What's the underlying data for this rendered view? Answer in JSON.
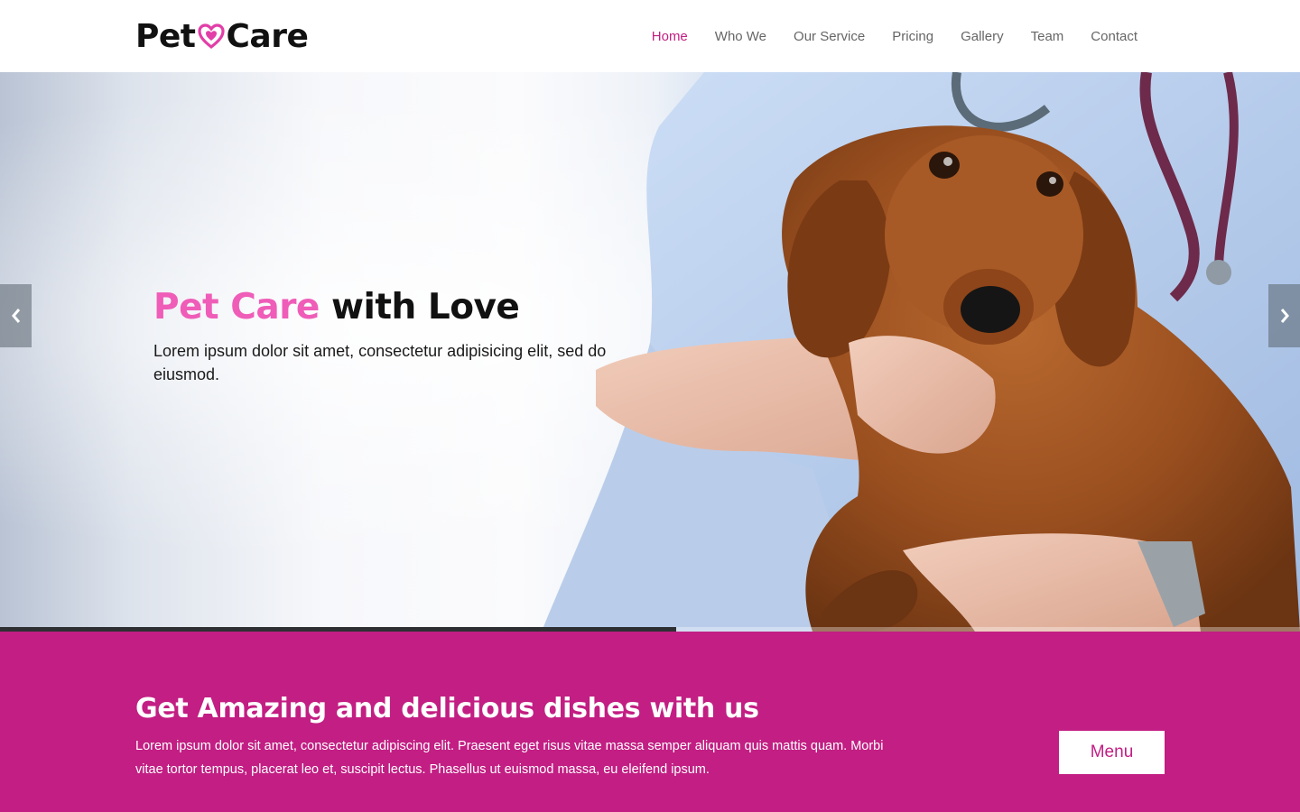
{
  "brand": {
    "logo_left": "Pet",
    "logo_right": "Care",
    "accent_color": "#c21e83",
    "heart_color": "#e23ea8",
    "logo_icon": "heart-icon"
  },
  "nav": {
    "items": [
      {
        "label": "Home",
        "active": true
      },
      {
        "label": "Who We",
        "active": false
      },
      {
        "label": "Our Service",
        "active": false
      },
      {
        "label": "Pricing",
        "active": false
      },
      {
        "label": "Gallery",
        "active": false
      },
      {
        "label": "Team",
        "active": false
      },
      {
        "label": "Contact",
        "active": false
      }
    ]
  },
  "hero": {
    "title_accent": "Pet Care",
    "title_rest": " with Love",
    "subtitle": "Lorem ipsum dolor sit amet, consectetur adipisicing elit, sed do eiusmod.",
    "prev_icon": "chevron-left-icon",
    "next_icon": "chevron-right-icon",
    "slide_progress": 0.52,
    "image": "veterinarian holding a dachshund dog"
  },
  "cta": {
    "title": "Get Amazing and delicious dishes with us",
    "text": "Lorem ipsum dolor sit amet, consectetur adipiscing elit. Praesent eget risus vitae massa semper aliquam quis mattis quam. Morbi vitae tortor tempus, placerat leo et, suscipit lectus. Phasellus ut euismod massa, eu eleifend ipsum.",
    "button_label": "Menu"
  }
}
